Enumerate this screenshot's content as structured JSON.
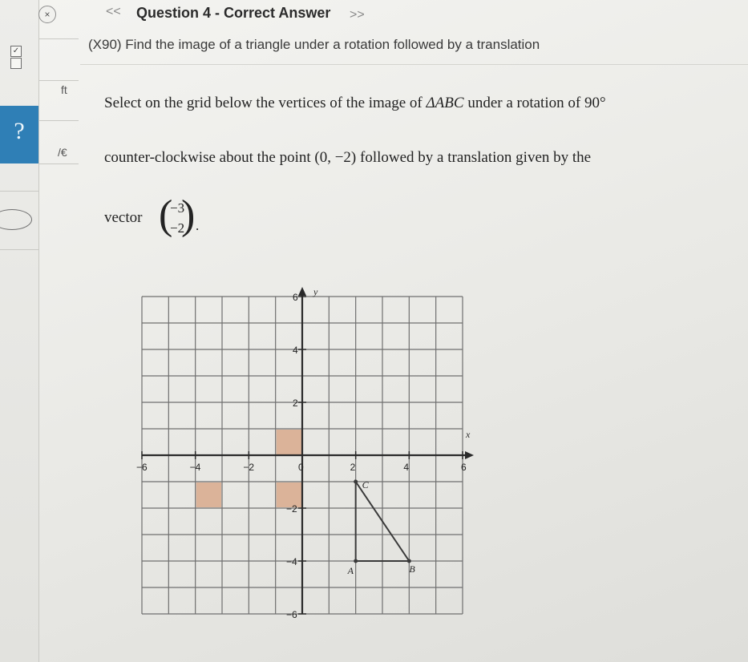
{
  "header": {
    "title": "Question 4 - Correct Answer",
    "prev": "<<",
    "next": ">>",
    "close": "×",
    "subtitle": "(X90) Find the image of a triangle under a rotation followed by a translation"
  },
  "sidebar": {
    "checkbox_mark": "✓",
    "fragment_top": "ft",
    "fragment_mid": "/€",
    "help": "?"
  },
  "question": {
    "line1_prefix": "Select on the grid below the vertices of the image of ",
    "triangle": "ΔABC",
    "line1_suffix": " under a rotation of ",
    "angle": "90°",
    "line2_prefix": "counter-clockwise about the point ",
    "point": "(0, −2)",
    "line2_suffix": " followed by a translation given by the",
    "vector_label": "vector",
    "vector_top": "−3",
    "vector_bottom": "−2",
    "period": "."
  },
  "chart_data": {
    "type": "scatter",
    "xlabel": "x",
    "ylabel": "y",
    "xlim": [
      -6,
      6
    ],
    "ylim": [
      -6,
      6
    ],
    "grid": true,
    "x_ticks": [
      "−6",
      "−4",
      "−2",
      "0",
      "2",
      "4",
      "6"
    ],
    "y_ticks": [
      "6",
      "4",
      "2",
      "−2",
      "−4",
      "−6"
    ],
    "triangle": {
      "vertices": [
        {
          "label": "A",
          "x": 2,
          "y": -4
        },
        {
          "label": "B",
          "x": 4,
          "y": -4
        },
        {
          "label": "C",
          "x": 2,
          "y": -1
        }
      ]
    },
    "selected_cells": [
      {
        "x": -1,
        "y": 0
      },
      {
        "x": -4,
        "y": -2
      },
      {
        "x": -1,
        "y": -2
      }
    ],
    "colors": {
      "grid": "#6f6f6f",
      "axis": "#2a2a2a",
      "triangle": "#3a3a3a",
      "selected": "#d8a98c"
    }
  }
}
